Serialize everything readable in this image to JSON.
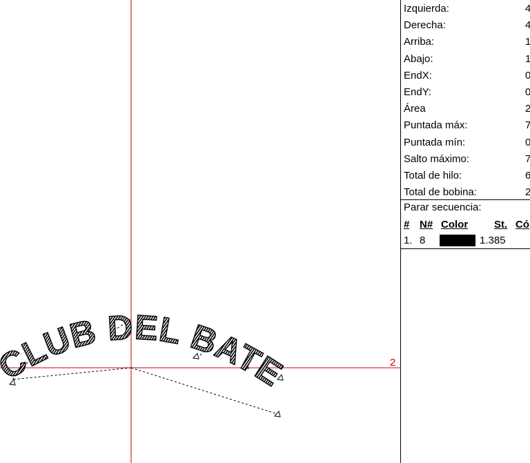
{
  "properties": [
    {
      "label": "Izquierda:",
      "value": "4"
    },
    {
      "label": "Derecha:",
      "value": "4"
    },
    {
      "label": "Arriba:",
      "value": "1"
    },
    {
      "label": "Abajo:",
      "value": "1"
    },
    {
      "label": "EndX:",
      "value": "0"
    },
    {
      "label": "EndY:",
      "value": "0"
    },
    {
      "label": "Área",
      "value": "2"
    },
    {
      "label": "Puntada máx:",
      "value": "7"
    },
    {
      "label": "Puntada mín:",
      "value": "0"
    },
    {
      "label": "Salto máximo:",
      "value": "7"
    },
    {
      "label": "Total de hilo:",
      "value": "6"
    },
    {
      "label": "Total de bobina:",
      "value": "2"
    }
  ],
  "sequence": {
    "title": "Parar secuencia:",
    "headers": {
      "num": "#",
      "needle": "N#",
      "color": "Color",
      "stitches": "St.",
      "code": "Có"
    },
    "rows": [
      {
        "num": "1.",
        "needle": "8",
        "color_hex": "#000000",
        "stitches": "1.385"
      }
    ]
  },
  "canvas": {
    "design_text": "CLUB DEL BATE",
    "marker_label": "2",
    "guide_color": "#cc0000",
    "thread_color": "#000000"
  }
}
